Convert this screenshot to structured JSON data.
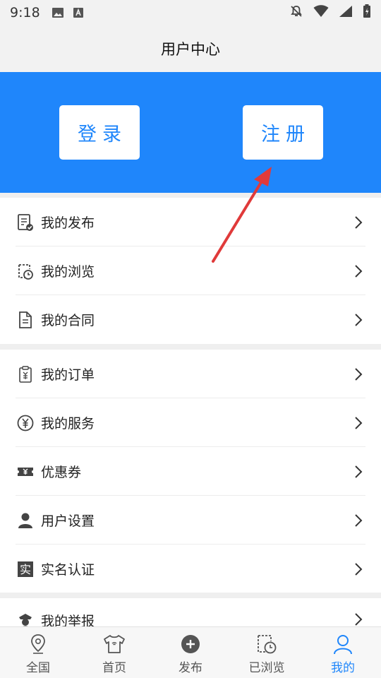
{
  "status_bar": {
    "time": "9:18",
    "icons_left": [
      "image-icon",
      "a-badge-icon"
    ],
    "icons_right": [
      "bell-off-icon",
      "wifi-icon",
      "signal-icon",
      "battery-icon"
    ]
  },
  "header": {
    "title": "用户中心"
  },
  "hero": {
    "background": "#1f86fb",
    "login_label": "登录",
    "register_label": "注册"
  },
  "menu": {
    "group1": [
      {
        "label": "我的发布",
        "icon": "document-check-icon"
      },
      {
        "label": "我的浏览",
        "icon": "history-clock-icon"
      },
      {
        "label": "我的合同",
        "icon": "contract-file-icon"
      }
    ],
    "group2": [
      {
        "label": "我的订单",
        "icon": "order-receipt-icon"
      },
      {
        "label": "我的服务",
        "icon": "yen-circle-icon"
      },
      {
        "label": "优惠券",
        "icon": "coupon-icon"
      },
      {
        "label": "用户设置",
        "icon": "user-icon"
      },
      {
        "label": "实名认证",
        "icon": "real-name-icon"
      }
    ],
    "group3": [
      {
        "label": "我的举报",
        "icon": "police-icon"
      }
    ],
    "real_name_glyph": "实"
  },
  "tab_bar": {
    "accent": "#1f86fb",
    "tabs": [
      {
        "label": "全国",
        "icon": "location-pin-icon"
      },
      {
        "label": "首页",
        "icon": "shirt-icon"
      },
      {
        "label": "发布",
        "icon": "plus-circle-icon"
      },
      {
        "label": "已浏览",
        "icon": "history-clock-icon"
      },
      {
        "label": "我的",
        "icon": "person-icon",
        "active": true
      }
    ]
  }
}
